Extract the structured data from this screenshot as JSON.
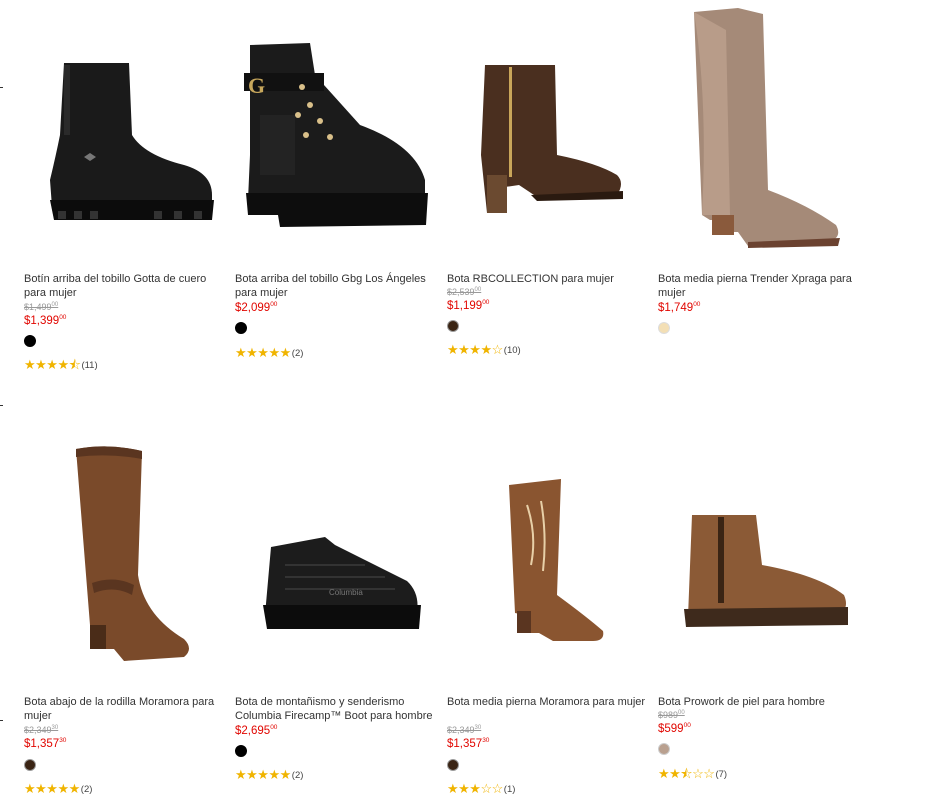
{
  "products": [
    {
      "title": "Botín arriba del tobillo Gotta de cuero para mujer",
      "old_price": "$1,499",
      "old_cents": "00",
      "price": "$1,399",
      "cents": "00",
      "swatch": "#000000",
      "stars": "★★★★⯪",
      "count": "(11)",
      "image": "black-chunky-ankle-boot"
    },
    {
      "title": "Bota arriba del tobillo Gbg Los Ángeles para mujer",
      "old_price": "",
      "old_cents": "",
      "price": "$2,099",
      "cents": "00",
      "swatch": "#000000",
      "stars": "★★★★★",
      "count": "(2)",
      "image": "black-combat-boot"
    },
    {
      "title": "Bota RBCOLLECTION para mujer",
      "old_price": "$2,539",
      "old_cents": "00",
      "price": "$1,199",
      "cents": "00",
      "swatch": "#3a2414",
      "stars": "★★★★☆",
      "count": "(10)",
      "image": "brown-heeled-ankle-boot"
    },
    {
      "title": "Bota media pierna Trender Xpraga para mujer",
      "old_price": "",
      "old_cents": "",
      "price": "$1,749",
      "cents": "00",
      "swatch": "#f3dfb5",
      "stars": "",
      "count": "",
      "image": "taupe-suede-boot"
    },
    {
      "title": "Bota abajo de la rodilla Moramora para mujer",
      "old_price": "$2,349",
      "old_cents": "30",
      "price": "$1,357",
      "cents": "30",
      "swatch": "#3a2414",
      "stars": "★★★★★",
      "count": "(2)",
      "image": "brown-knee-boot"
    },
    {
      "title": "Bota de montañismo y senderismo Columbia Firecamp™ Boot para hombre",
      "old_price": "",
      "old_cents": "",
      "price": "$2,695",
      "cents": "00",
      "swatch": "#000000",
      "stars": "★★★★★",
      "count": "(2)",
      "image": "black-hiking-boot"
    },
    {
      "title": "Bota media pierna Moramora para mujer",
      "old_price": "$2,349",
      "old_cents": "30",
      "price": "$1,357",
      "cents": "30",
      "swatch": "#3a2414",
      "stars": "★★★☆☆",
      "count": "(1)",
      "image": "brown-western-boot"
    },
    {
      "title": "Bota Prowork de piel para hombre",
      "old_price": "$989",
      "old_cents": "00",
      "price": "$599",
      "cents": "00",
      "swatch": "#b9a08f",
      "stars": "★★⯪☆☆",
      "count": "(7)",
      "image": "brown-chelsea-boot"
    }
  ]
}
